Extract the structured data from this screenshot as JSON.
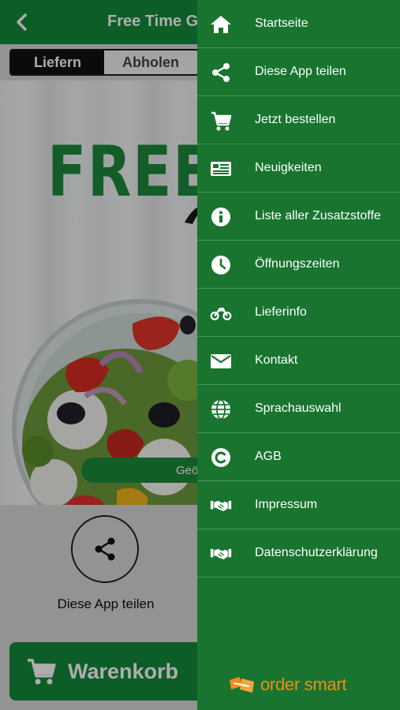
{
  "app": {
    "title": "Free Time Gri",
    "tabs": {
      "deliver": "Liefern",
      "pickup": "Abholen"
    },
    "hero_logo": "FREE-",
    "open_status": "Geö",
    "share_label": "Diese App teilen",
    "cart_label": "Warenkorb"
  },
  "drawer": {
    "items": [
      {
        "label": "Startseite",
        "icon": "home-icon"
      },
      {
        "label": "Diese App teilen",
        "icon": "share-icon"
      },
      {
        "label": "Jetzt bestellen",
        "icon": "cart-icon"
      },
      {
        "label": "Neuigkeiten",
        "icon": "newspaper-icon"
      },
      {
        "label": "Liste aller Zusatzstoffe",
        "icon": "info-icon"
      },
      {
        "label": "Öffnungszeiten",
        "icon": "clock-icon"
      },
      {
        "label": "Lieferinfo",
        "icon": "motorcycle-icon"
      },
      {
        "label": "Kontakt",
        "icon": "envelope-icon"
      },
      {
        "label": "Sprachauswahl",
        "icon": "globe-icon"
      },
      {
        "label": "AGB",
        "icon": "copyright-icon"
      },
      {
        "label": "Impressum",
        "icon": "handshake-icon"
      },
      {
        "label": "Datenschutzerklärung",
        "icon": "handshake-icon"
      }
    ],
    "brand": "order smart"
  },
  "colors": {
    "primary_green": "#138a3a",
    "drawer_green": "#18742f",
    "brand_orange": "#f28b1c"
  }
}
